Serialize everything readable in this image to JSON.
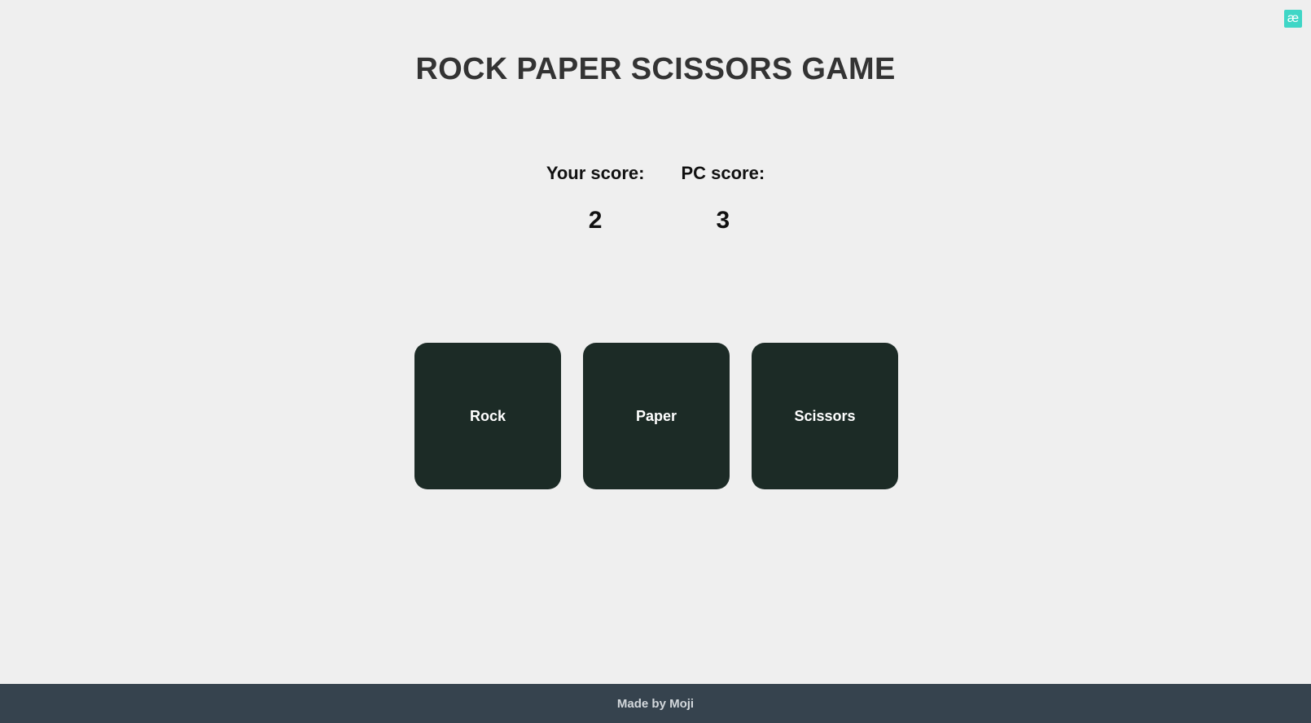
{
  "badge": {
    "glyph": "æ"
  },
  "header": {
    "title": "ROCK PAPER SCISSORS GAME"
  },
  "scores": {
    "player": {
      "label": "Your score:",
      "value": "2"
    },
    "pc": {
      "label": "PC score:",
      "value": "3"
    }
  },
  "choices": {
    "rock": "Rock",
    "paper": "Paper",
    "scissors": "Scissors"
  },
  "footer": {
    "text": "Made by Moji"
  },
  "colors": {
    "background": "#efefef",
    "button": "#1c2b26",
    "footer": "#36434e",
    "badge": "#3fd6c6"
  }
}
